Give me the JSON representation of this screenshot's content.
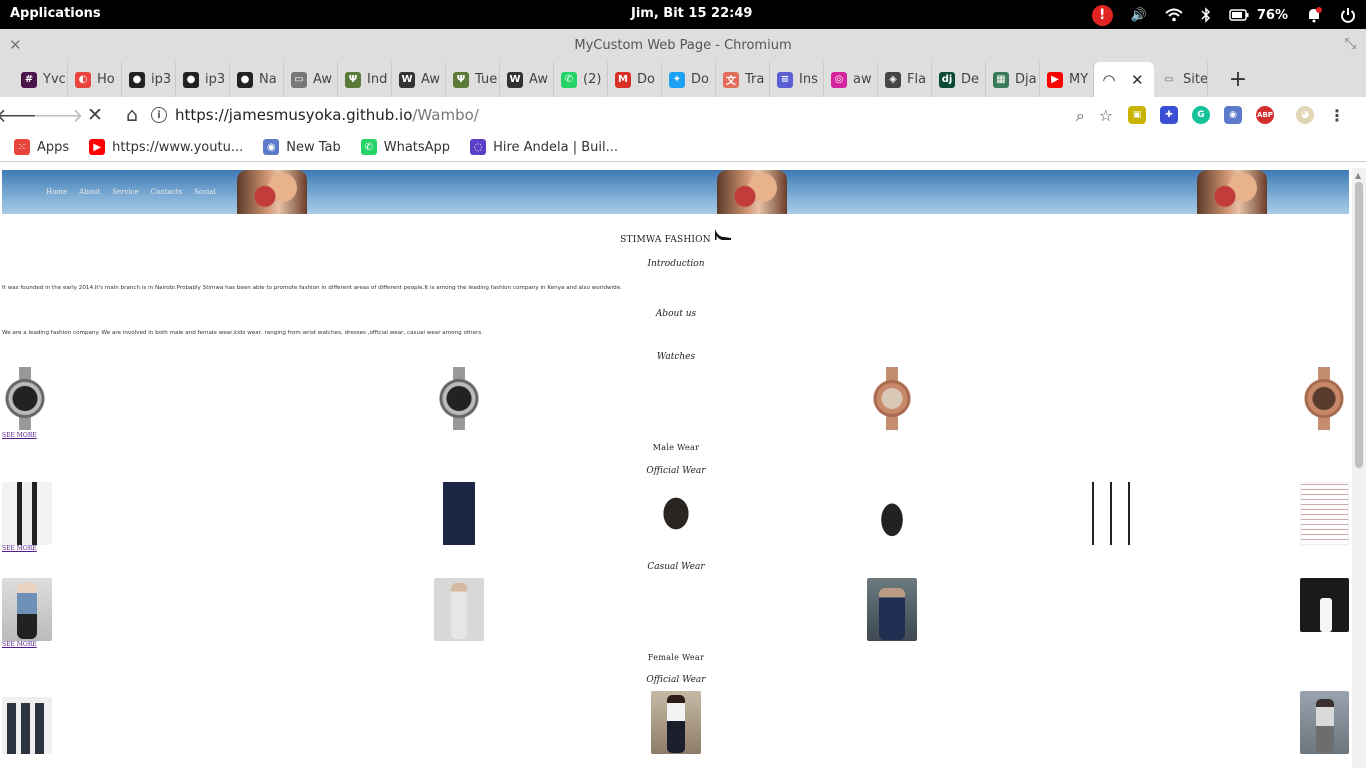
{
  "system": {
    "apps_label": "Applications",
    "datetime": "Jim, Bit 15   22:49",
    "alert": "!",
    "battery": "76%"
  },
  "window": {
    "title": "MyCustom Web Page - Chromium"
  },
  "tabs": [
    {
      "label": "Yvc",
      "icon": "slack-icon",
      "color": "#4a154b"
    },
    {
      "label": "Ho",
      "icon": "colorful-circle-icon",
      "color": "#e8453c"
    },
    {
      "label": "ip3",
      "icon": "github-icon",
      "color": "#222222"
    },
    {
      "label": "ip3",
      "icon": "github-icon",
      "color": "#222222"
    },
    {
      "label": "Na",
      "icon": "github-icon",
      "color": "#222222"
    },
    {
      "label": "Aw",
      "icon": "document-icon",
      "color": "#777777"
    },
    {
      "label": "Ind",
      "icon": "palm-tree-icon",
      "color": "#5a7a3a"
    },
    {
      "label": "Aw",
      "icon": "wikipedia-icon",
      "color": "#333333"
    },
    {
      "label": "Tue",
      "icon": "palm-tree-icon",
      "color": "#5a7a3a"
    },
    {
      "label": "Aw",
      "icon": "wikipedia-icon",
      "color": "#333333"
    },
    {
      "label": "(2)",
      "icon": "whatsapp-icon",
      "color": "#25d366"
    },
    {
      "label": "Do",
      "icon": "gmail-icon",
      "color": "#d93025"
    },
    {
      "label": "Do",
      "icon": "twitter-icon",
      "color": "#1da1f2"
    },
    {
      "label": "Tra",
      "icon": "translate-icon",
      "color": "#e26d5c"
    },
    {
      "label": "Ins",
      "icon": "forms-icon",
      "color": "#5b5fd6"
    },
    {
      "label": "aw",
      "icon": "instagram-icon",
      "color": "#d6249f"
    },
    {
      "label": "Fla",
      "icon": "flask-icon",
      "color": "#444444"
    },
    {
      "label": "De",
      "icon": "django-icon",
      "color": "#0c4b33"
    },
    {
      "label": "Dja",
      "icon": "grid-icon",
      "color": "#3b7a57"
    },
    {
      "label": "MY",
      "icon": "youtube-icon",
      "color": "#ff0000"
    }
  ],
  "active_tab": {
    "label": "",
    "icon": "loading-icon"
  },
  "last_tab": {
    "label": "Site",
    "icon": "document-icon"
  },
  "toolbar": {
    "url_host": "https://jamesmusyoka.github.io",
    "url_path": "/Wambo/"
  },
  "bookmarks": [
    {
      "label": "Apps",
      "icon": "apps-grid-icon",
      "color": "#e8453c"
    },
    {
      "label": "https://www.youtu...",
      "icon": "youtube-icon",
      "color": "#ff0000"
    },
    {
      "label": "New Tab",
      "icon": "newtab-icon",
      "color": "#5b7ac9"
    },
    {
      "label": "WhatsApp",
      "icon": "whatsapp-icon",
      "color": "#25d366"
    },
    {
      "label": "Hire Andela | Buil...",
      "icon": "andela-icon",
      "color": "#5b3fc7"
    }
  ],
  "page": {
    "nav": [
      "Home",
      "About",
      "Service",
      "Contacts",
      "Social"
    ],
    "brand": "STIMWA FASHION",
    "intro_heading": "Introduction",
    "intro_text": "It was founded in the early 2014.It's main branch is in Nairobi.Probably Stimwa has been able to promote fashion in different areas of different people.It is among the leading fashion company in Kenya and also worldwide.",
    "about_heading": "About us",
    "about_text": "We are a leading fashion company. We are involved in both male and female wear,kids wear, ranging from wrist watches, dresses ,official wear, casual wear among others.",
    "watches_heading": "Watches",
    "see_more": "SEE MORE",
    "male_heading": "Male Wear",
    "official_heading": "Official Wear",
    "casual_heading": "Casual Wear",
    "female_heading": "Female Wear"
  }
}
